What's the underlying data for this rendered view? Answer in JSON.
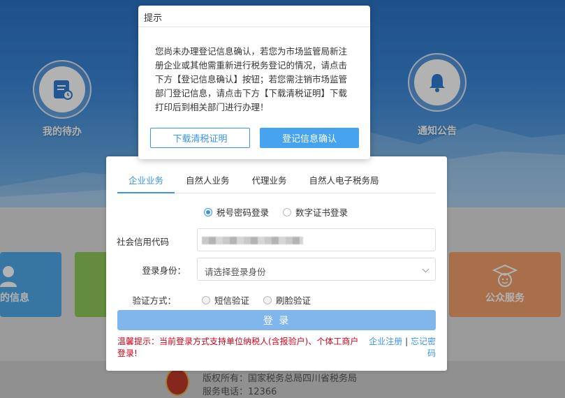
{
  "background": {
    "quick_links": [
      {
        "label": "我的待办",
        "icon": "todo-calendar-icon"
      },
      {
        "label": "通知公告",
        "icon": "bell-icon"
      }
    ],
    "tiles": [
      {
        "label": "的信息",
        "color": "#4fa8e8",
        "icon": "user-icon"
      },
      {
        "label": "",
        "color": "#8fc95a",
        "icon": ""
      },
      {
        "label": "公众服务",
        "color": "#f0a06a",
        "icon": "graduate-icon"
      }
    ],
    "footer": {
      "copyright": "版权所有：国家税务总局四川省税务局",
      "phone": "服务电话：12366"
    }
  },
  "login": {
    "tabs": [
      {
        "label": "企业业务",
        "active": true
      },
      {
        "label": "自然人业务",
        "active": false
      },
      {
        "label": "代理业务",
        "active": false
      },
      {
        "label": "自然人电子税务局",
        "active": false
      }
    ],
    "login_methods": [
      {
        "label": "税号密码登录",
        "selected": true
      },
      {
        "label": "数字证书登录",
        "selected": false
      }
    ],
    "credit_code_label": "社会信用代码",
    "identity_label": "登录身份：",
    "identity_placeholder": "请选择登录身份",
    "verify_label": "验证方式：",
    "verify_methods": [
      {
        "label": "短信验证"
      },
      {
        "label": "刷脸验证"
      }
    ],
    "login_button": "登 录",
    "tip": "温馨提示：当前登录方式支持单位纳税人(含报验户)、个体工商户登录!",
    "register_link": "企业注册",
    "separator": "|",
    "forgot_link": "忘记密码"
  },
  "modal": {
    "title": "提示",
    "body": "您尚未办理登记信息确认，若您为市场监管局新注册企业或其他需重新进行税务登记的情况，请点击下方【登记信息确认】按钮；若您需注销市场监管部门登记信息，请点击下方【下载清税证明】下载打印后到相关部门进行办理！",
    "download_button": "下载清税证明",
    "confirm_button": "登记信息确认"
  }
}
